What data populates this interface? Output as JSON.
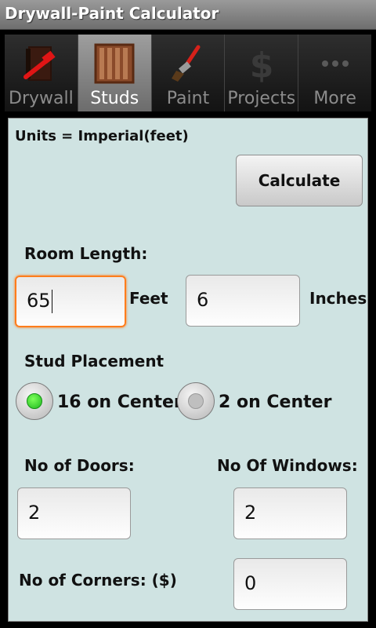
{
  "app": {
    "title": "Drywall-Paint Calculator"
  },
  "tabs": [
    {
      "label": "Drywall",
      "icon": "hammer-icon",
      "active": false
    },
    {
      "label": "Studs",
      "icon": "studs-icon",
      "active": true
    },
    {
      "label": "Paint",
      "icon": "paintbrush-icon",
      "active": false
    },
    {
      "label": "Projects",
      "icon": "dollar-icon",
      "active": false
    },
    {
      "label": "More",
      "icon": "more-dots-icon",
      "active": false
    }
  ],
  "form": {
    "units_label": "Units = Imperial(feet)",
    "calculate_label": "Calculate",
    "room_length_label": "Room Length:",
    "feet_value": "65",
    "feet_label": "Feet",
    "inches_value": "6",
    "inches_label": "Inches",
    "stud_placement_label": "Stud Placement",
    "radio_options": [
      {
        "label": "16 on Center",
        "checked": true
      },
      {
        "label": "2 on Center",
        "checked": false
      }
    ],
    "doors_label": "No of Doors:",
    "doors_value": "2",
    "windows_label": "No Of Windows:",
    "windows_value": "2",
    "corners_label": "No of Corners: ($)",
    "corners_value": "0"
  },
  "colors": {
    "accent_focus": "#ff7d1c",
    "content_bg": "#cfe3e2",
    "radio_checked": "#1eb81e"
  }
}
